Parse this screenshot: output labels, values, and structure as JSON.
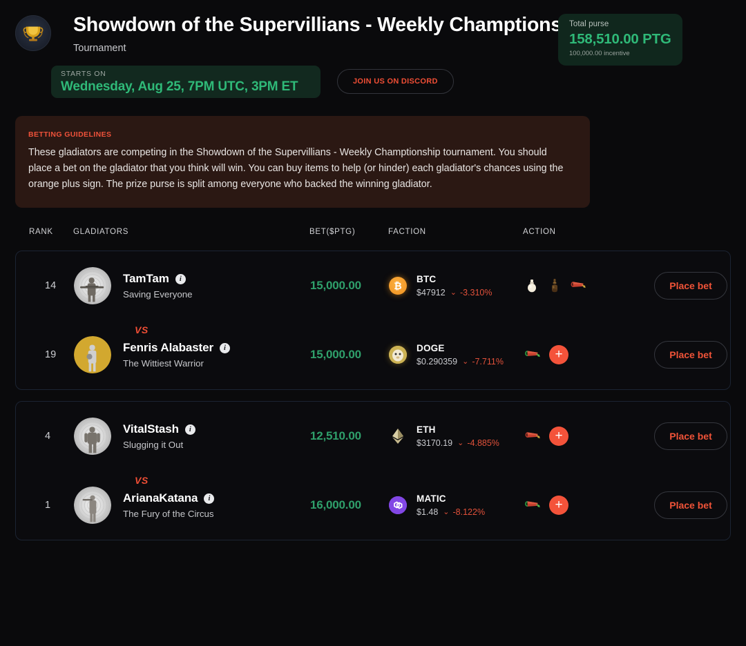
{
  "header": {
    "logo_icon": "trophy-icon",
    "title": "Showdown of the Supervillians - Weekly Champtionship",
    "subtitle": "Tournament",
    "purse": {
      "label": "Total purse",
      "value": "158,510.00 PTG",
      "incentive": "100,000.00 incentive"
    },
    "starts": {
      "label": "STARTS ON",
      "value": "Wednesday, Aug 25, 7PM UTC, 3PM ET"
    },
    "discord_button": "JOIN US ON DISCORD"
  },
  "guidelines": {
    "label": "BETTING GUIDELINES",
    "text": "These gladiators are competing in the Showdown of the Supervillians - Weekly Champtionship tournament. You should place a bet on the gladiator that you think will win. You can buy items to help (or hinder) each gladiator's chances using the orange plus sign. The prize purse is split among everyone who backed the winning gladiator."
  },
  "table": {
    "columns": {
      "rank": "RANK",
      "gladiators": "GLADIATORS",
      "bet": "BET($PTG)",
      "faction": "FACTION",
      "action": "ACTION"
    },
    "vs_label": "VS",
    "place_bet_label": "Place bet",
    "info_glyph": "i",
    "plus_glyph": "+",
    "down_arrow_glyph": "⌄"
  },
  "matches": [
    {
      "gladiators": [
        {
          "rank": "14",
          "name": "TamTam",
          "description": "Saving Everyone",
          "bet": "15,000.00",
          "faction": {
            "symbol": "BTC",
            "price": "$47912",
            "change": "-3.310%"
          },
          "items": [
            "white-potion-icon",
            "brown-bottle-icon",
            "red-cannon-icon"
          ],
          "has_plus": false,
          "place_bet": "Place bet"
        },
        {
          "rank": "19",
          "name": "Fenris Alabaster",
          "description": "The Wittiest Warrior",
          "bet": "15,000.00",
          "faction": {
            "symbol": "DOGE",
            "price": "$0.290359",
            "change": "-7.711%"
          },
          "items": [
            "green-cannon-icon"
          ],
          "has_plus": true,
          "place_bet": "Place bet"
        }
      ]
    },
    {
      "gladiators": [
        {
          "rank": "4",
          "name": "VitalStash",
          "description": "Slugging it Out",
          "bet": "12,510.00",
          "faction": {
            "symbol": "ETH",
            "price": "$3170.19",
            "change": "-4.885%"
          },
          "items": [
            "red-cannon-icon"
          ],
          "has_plus": true,
          "place_bet": "Place bet"
        },
        {
          "rank": "1",
          "name": "ArianaKatana",
          "description": "The Fury of the Circus",
          "bet": "16,000.00",
          "faction": {
            "symbol": "MATIC",
            "price": "$1.48",
            "change": "-8.122%"
          },
          "items": [
            "green-cannon-icon"
          ],
          "has_plus": true,
          "place_bet": "Place bet"
        }
      ]
    }
  ],
  "colors": {
    "background": "#0a0a0c",
    "accent_green": "#2fb978",
    "accent_orange": "#f04e35",
    "bet_green": "#2fa06b",
    "guidelines_bg": "#2b1813",
    "purse_bg": "#10271d"
  }
}
